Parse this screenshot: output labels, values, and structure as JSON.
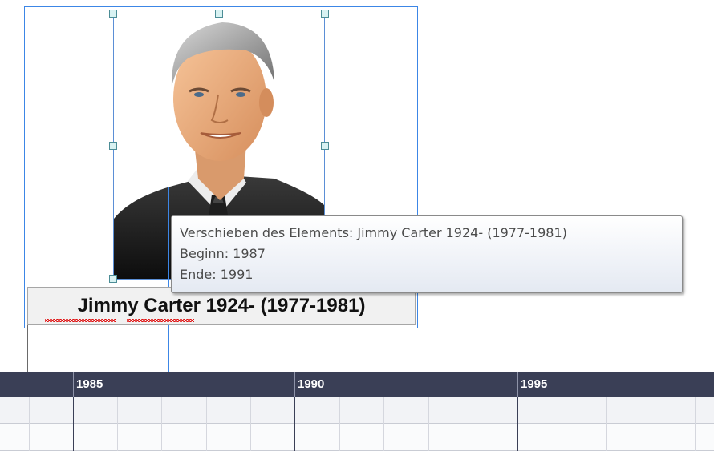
{
  "caption": {
    "text": "Jimmy Carter 1924- (1977-1981)"
  },
  "tooltip": {
    "line1": "Verschieben des Elements: Jimmy Carter 1924- (1977-1981)",
    "line2": "Beginn: 1987",
    "line3": "Ende: 1991"
  },
  "timeline": {
    "years": [
      "1985",
      "1990",
      "1995"
    ]
  },
  "colors": {
    "selection": "#3c86e6",
    "timeline_header": "#3a3f56",
    "spell_error": "#e01010"
  }
}
